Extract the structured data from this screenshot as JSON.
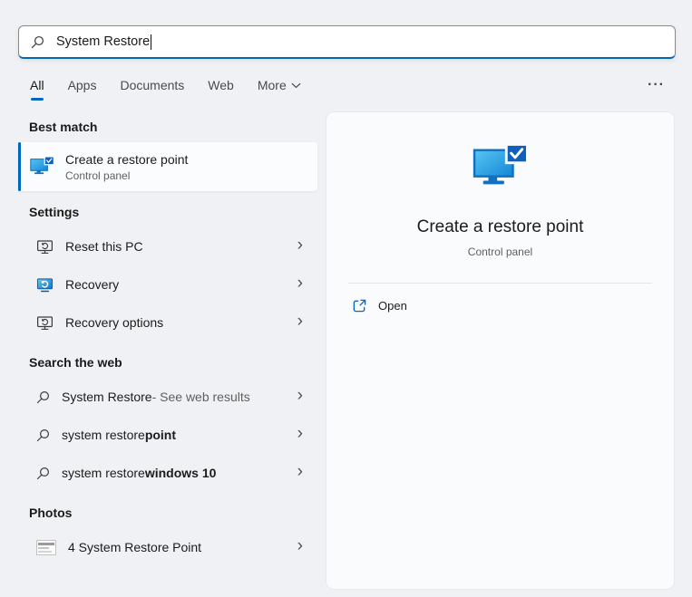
{
  "search": {
    "value": "System Restore",
    "placeholder": ""
  },
  "tabs": [
    {
      "label": "All",
      "active": true
    },
    {
      "label": "Apps",
      "active": false
    },
    {
      "label": "Documents",
      "active": false
    },
    {
      "label": "Web",
      "active": false
    },
    {
      "label": "More",
      "active": false
    }
  ],
  "sections": {
    "best_match": {
      "header": "Best match",
      "item": {
        "title": "Create a restore point",
        "subtitle": "Control panel"
      }
    },
    "settings": {
      "header": "Settings",
      "items": [
        {
          "label": "Reset this PC"
        },
        {
          "label": "Recovery"
        },
        {
          "label": "Recovery options"
        }
      ]
    },
    "web": {
      "header": "Search the web",
      "items": [
        {
          "text": "System Restore",
          "suffix": " - See web results"
        },
        {
          "text": "system restore ",
          "bold": "point"
        },
        {
          "text": "system restore ",
          "bold": "windows 10"
        }
      ]
    },
    "photos": {
      "header": "Photos",
      "items": [
        {
          "label": "4 System Restore Point"
        }
      ]
    }
  },
  "preview": {
    "title": "Create a restore point",
    "subtitle": "Control panel",
    "open_label": "Open"
  },
  "icons": {
    "search": "magnifier",
    "chevron_right": "›",
    "chevron_down": "chevron-down",
    "ellipsis": "···",
    "best_match_app": "monitor-with-checkmark",
    "reset_pc": "monitor-refresh-outline",
    "recovery": "monitor-refresh-blue",
    "recovery_options": "monitor-refresh-outline",
    "photos_thumb": "photo-thumbnail",
    "open": "open-window-arrow"
  },
  "colors": {
    "accent": "#0067c0",
    "background": "#eff1f4",
    "panel": "#fafbfc"
  }
}
